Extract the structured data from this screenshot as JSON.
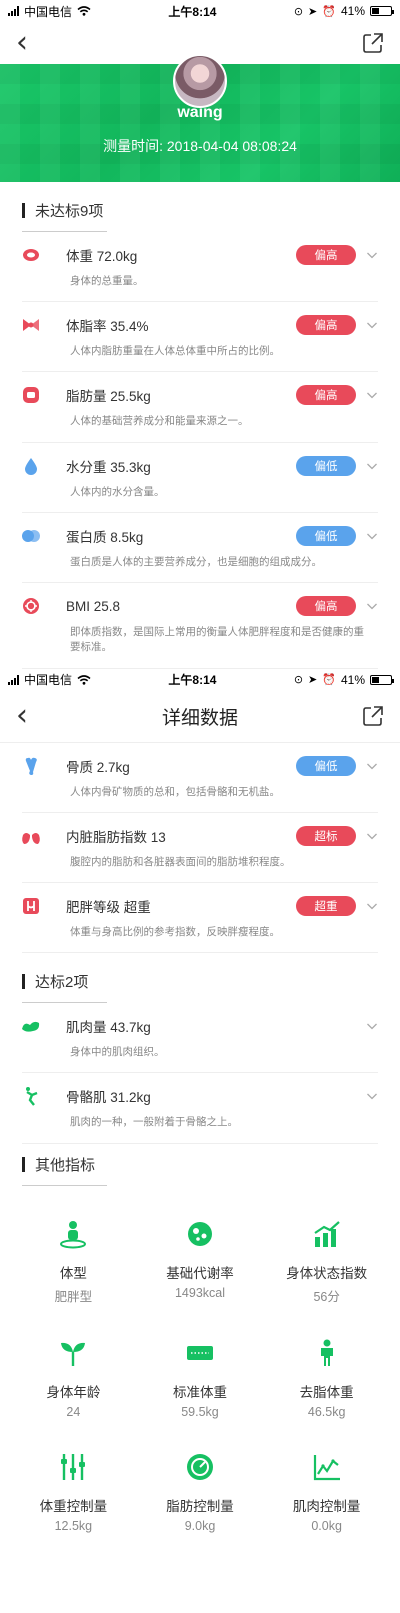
{
  "status1": {
    "carrier": "中国电信",
    "time": "上午8:14",
    "battery": "41%"
  },
  "status2": {
    "carrier": "中国电信",
    "time": "上午8:14",
    "battery": "41%"
  },
  "header": {
    "username": "waing",
    "measure_time": "测量时间: 2018-04-04 08:08:24"
  },
  "nav2": {
    "title": "详细数据"
  },
  "unmet": {
    "title": "未达标9项",
    "items": [
      {
        "name": "体重 72.0kg",
        "desc": "身体的总重量。",
        "badge": "偏高",
        "level": "high",
        "icon": "weight-icon"
      },
      {
        "name": "体脂率 35.4%",
        "desc": "人体内脂肪重量在人体总体重中所占的比例。",
        "badge": "偏高",
        "level": "high",
        "icon": "body-fat-rate-icon"
      },
      {
        "name": "脂肪量 25.5kg",
        "desc": "人体的基础营养成分和能量来源之一。",
        "badge": "偏高",
        "level": "high",
        "icon": "fat-mass-icon"
      },
      {
        "name": "水分重 35.3kg",
        "desc": "人体内的水分含量。",
        "badge": "偏低",
        "level": "low",
        "icon": "water-drop-icon"
      },
      {
        "name": "蛋白质 8.5kg",
        "desc": "蛋白质是人体的主要营养成分，也是细胞的组成成分。",
        "badge": "偏低",
        "level": "low",
        "icon": "protein-icon"
      },
      {
        "name": "BMI 25.8",
        "desc": "即体质指数，是国际上常用的衡量人体肥胖程度和是否健康的重要标准。",
        "badge": "偏高",
        "level": "high",
        "icon": "bmi-icon"
      }
    ],
    "items2": [
      {
        "name": "骨质 2.7kg",
        "desc": "人体内骨矿物质的总和，包括骨骼和无机盐。",
        "badge": "偏低",
        "level": "low",
        "icon": "bone-icon"
      },
      {
        "name": "内脏脂肪指数 13",
        "desc": "腹腔内的脂肪和各脏器表面间的脂肪堆积程度。",
        "badge": "超标",
        "level": "high",
        "icon": "visceral-fat-icon"
      },
      {
        "name": "肥胖等级 超重",
        "desc": "体重与身高比例的参考指数，反映胖瘦程度。",
        "badge": "超重",
        "level": "high",
        "icon": "obesity-level-icon"
      }
    ]
  },
  "met": {
    "title": "达标2项",
    "items": [
      {
        "name": "肌肉量 43.7kg",
        "desc": "身体中的肌肉组织。",
        "icon": "muscle-icon"
      },
      {
        "name": "骨骼肌 31.2kg",
        "desc": "肌肉的一种，一般附着于骨骼之上。",
        "icon": "skeletal-muscle-icon"
      }
    ]
  },
  "other": {
    "title": "其他指标",
    "cells": [
      {
        "label": "体型",
        "value": "肥胖型",
        "icon": "body-type-icon"
      },
      {
        "label": "基础代谢率",
        "value": "1493kcal",
        "icon": "metabolism-icon"
      },
      {
        "label": "身体状态指数",
        "value": "56分",
        "icon": "status-chart-icon"
      },
      {
        "label": "身体年龄",
        "value": "24",
        "icon": "sprout-icon"
      },
      {
        "label": "标准体重",
        "value": "59.5kg",
        "icon": "scale-icon"
      },
      {
        "label": "去脂体重",
        "value": "46.5kg",
        "icon": "person-icon"
      },
      {
        "label": "体重控制量",
        "value": "12.5kg",
        "icon": "sliders-icon"
      },
      {
        "label": "脂肪控制量",
        "value": "9.0kg",
        "icon": "gauge-icon"
      },
      {
        "label": "肌肉控制量",
        "value": "0.0kg",
        "icon": "line-chart-icon"
      }
    ]
  },
  "colors": {
    "green": "#16c062",
    "high": "#e84a5a",
    "low": "#5aa3ec"
  }
}
